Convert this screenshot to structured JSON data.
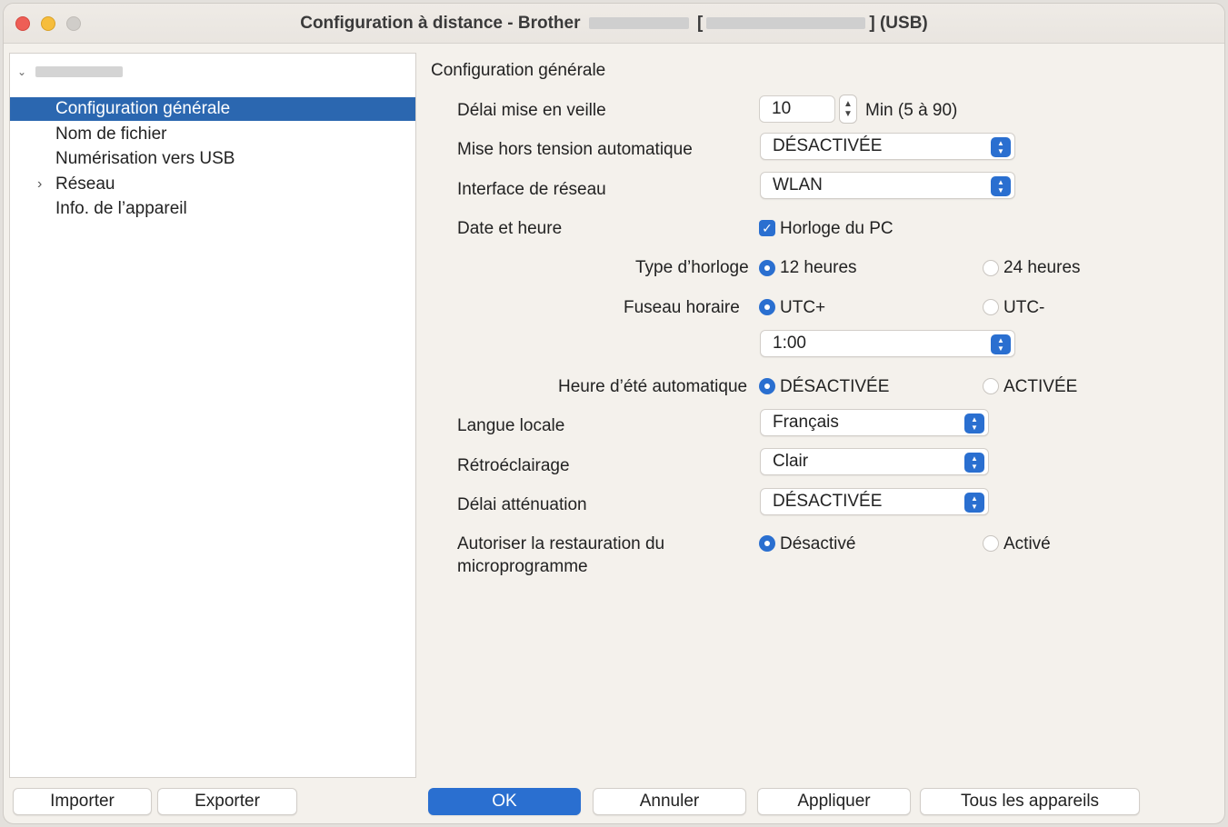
{
  "window": {
    "title_prefix": "Configuration à distance - Brother",
    "title_bracket_open": "[",
    "title_suffix": "] (USB)"
  },
  "sidebar": {
    "items": [
      {
        "label": "Configuration générale",
        "selected": true
      },
      {
        "label": "Nom de fichier"
      },
      {
        "label": "Numérisation vers USB"
      },
      {
        "label": "Réseau",
        "expandable": true
      },
      {
        "label": "Info. de l’appareil"
      }
    ]
  },
  "panel": {
    "title": "Configuration générale",
    "sleep": {
      "label": "Délai mise en veille",
      "value": "10",
      "unit": "Min (5 à 90)"
    },
    "auto_off": {
      "label": "Mise hors tension automatique",
      "value": "DÉSACTIVÉE"
    },
    "network_interface": {
      "label": "Interface de réseau",
      "value": "WLAN"
    },
    "date_time": {
      "label": "Date et heure",
      "checkbox_label": "Horloge du PC",
      "checked": true
    },
    "clock_type": {
      "label": "Type d’horloge",
      "option1": "12 heures",
      "option2": "24 heures",
      "selected": "12 heures"
    },
    "timezone": {
      "label": "Fuseau horaire",
      "option1": "UTC+",
      "option2": "UTC-",
      "selected": "UTC+",
      "offset": "1:00"
    },
    "dst": {
      "label": "Heure d’été automatique",
      "option1": "DÉSACTIVÉE",
      "option2": "ACTIVÉE",
      "selected": "DÉSACTIVÉE"
    },
    "locale": {
      "label": "Langue locale",
      "value": "Français"
    },
    "backlight": {
      "label": "Rétroéclairage",
      "value": "Clair"
    },
    "dim_timer": {
      "label": "Délai atténuation",
      "value": "DÉSACTIVÉE"
    },
    "firmware_restore": {
      "label_line1": "Autoriser la restauration du",
      "label_line2": "microprogramme",
      "option1": "Désactivé",
      "option2": "Activé",
      "selected": "Désactivé"
    }
  },
  "footer": {
    "import": "Importer",
    "export": "Exporter",
    "ok": "OK",
    "cancel": "Annuler",
    "apply": "Appliquer",
    "all_devices": "Tous les appareils"
  },
  "colors": {
    "accent": "#2a6fd0",
    "selection": "#2b67b0"
  },
  "icons": {
    "stepper": "stepper-arrows-icon",
    "select": "select-arrows-icon",
    "tree_expand": "chevron-right-icon",
    "tree_collapse": "chevron-down-icon"
  }
}
